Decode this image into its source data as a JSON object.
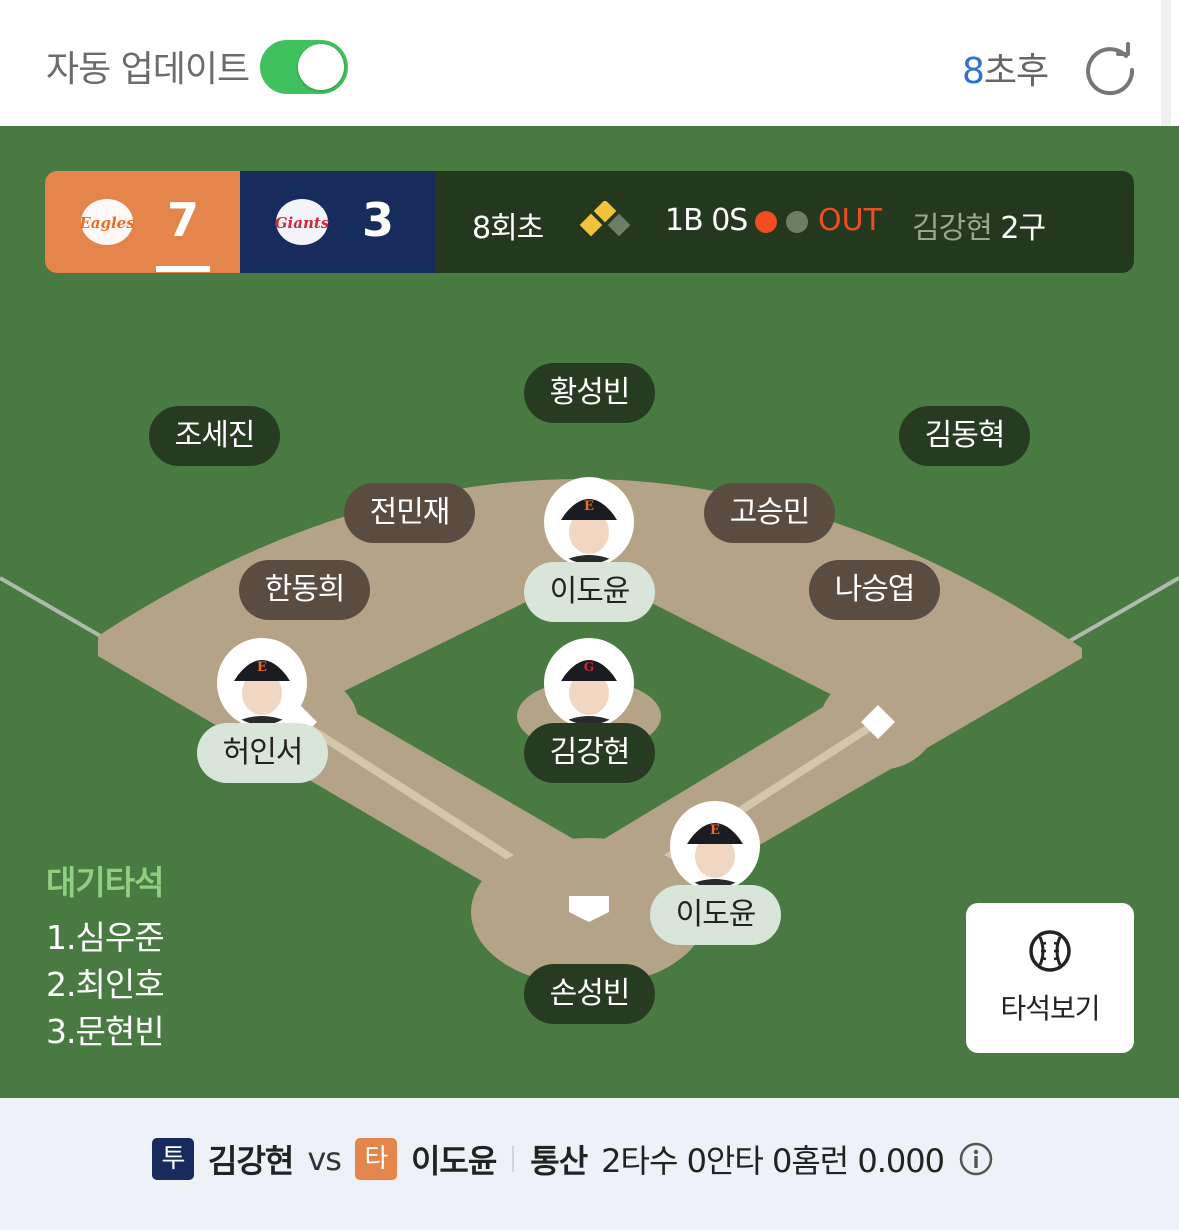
{
  "topbar": {
    "auto_update_label": "자동 업데이트",
    "auto_update_on": true,
    "countdown_number": "8",
    "countdown_suffix": "초후",
    "refresh_icon": "refresh-icon"
  },
  "scoreboard": {
    "away": {
      "logo": "eagles-logo",
      "score": "7",
      "color": "#e4854c"
    },
    "home": {
      "logo": "giants-logo",
      "score": "3",
      "color": "#172b5c"
    },
    "inning": "8회초",
    "bases_icon": "base-runner-diamond-icon",
    "count": "1B 0S",
    "out_label": "OUT",
    "pitcher_name": "김강현",
    "pitch_count": "2구"
  },
  "field": {
    "fielders": {
      "center": "황성빈",
      "left": "조세진",
      "right": "김동혁",
      "shortstop": "전민재",
      "second_base": "고승민",
      "third_base": "한동희",
      "first_base": "나승엽",
      "catcher": "손성빈"
    },
    "runners": {
      "second": "이도윤",
      "third": "허인서"
    },
    "pitcher": "김강현",
    "batter": "이도윤"
  },
  "on_deck": {
    "title": "대기타석",
    "batters": [
      "1.심우준",
      "2.최인호",
      "3.문현빈"
    ]
  },
  "lineup_button": {
    "label": "타석보기",
    "icon": "baseball-icon"
  },
  "matchup": {
    "pitcher_tag": "투",
    "pitcher_name": "김강현",
    "vs": "vs",
    "batter_tag": "타",
    "batter_name": "이도윤",
    "career_label": "통산",
    "career_stats": "2타수 0안타 0홈런 0.000",
    "info_icon": "info-icon"
  }
}
